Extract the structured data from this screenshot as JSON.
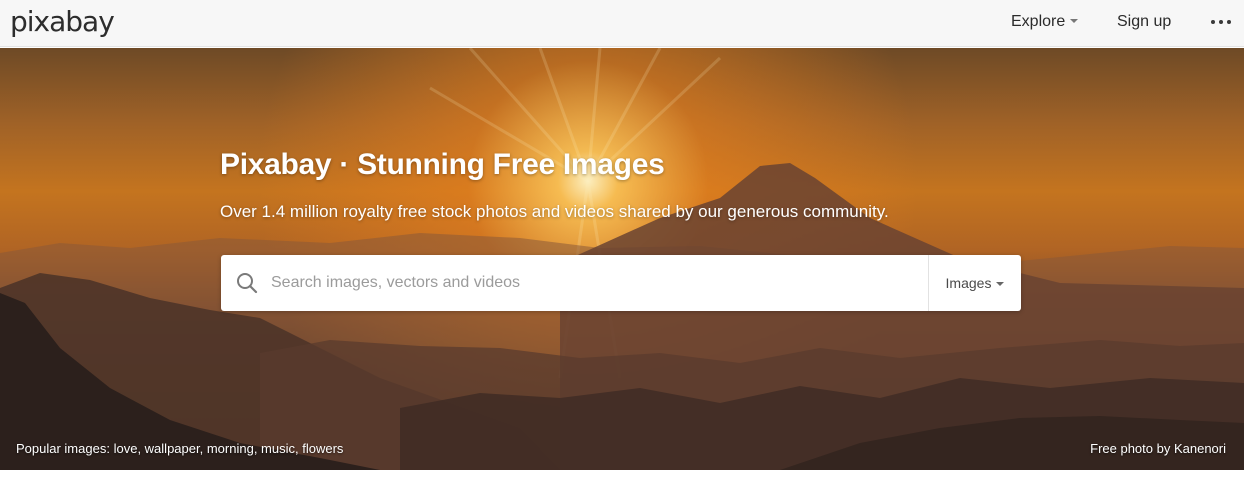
{
  "header": {
    "logo": "pixabay",
    "explore_label": "Explore",
    "signup_label": "Sign up"
  },
  "hero": {
    "title": "Pixabay · Stunning Free Images",
    "subtitle": "Over 1.4 million royalty free stock photos and videos shared by our generous community."
  },
  "search": {
    "placeholder": "Search images, vectors and videos",
    "type_label": "Images"
  },
  "footer": {
    "popular_prefix": "Popular images:",
    "popular_tags": [
      "love",
      "wallpaper",
      "morning",
      "music",
      "flowers"
    ],
    "credit": "Free photo by Kanenori"
  },
  "icons": {
    "search": "search-icon",
    "explore_caret": "caret-down-icon",
    "type_caret": "caret-down-icon",
    "more": "more-dots-icon"
  },
  "colors": {
    "topbar": "#f7f7f7",
    "text_dark": "#2b2b2b",
    "sky_orange": "#c4741f"
  }
}
